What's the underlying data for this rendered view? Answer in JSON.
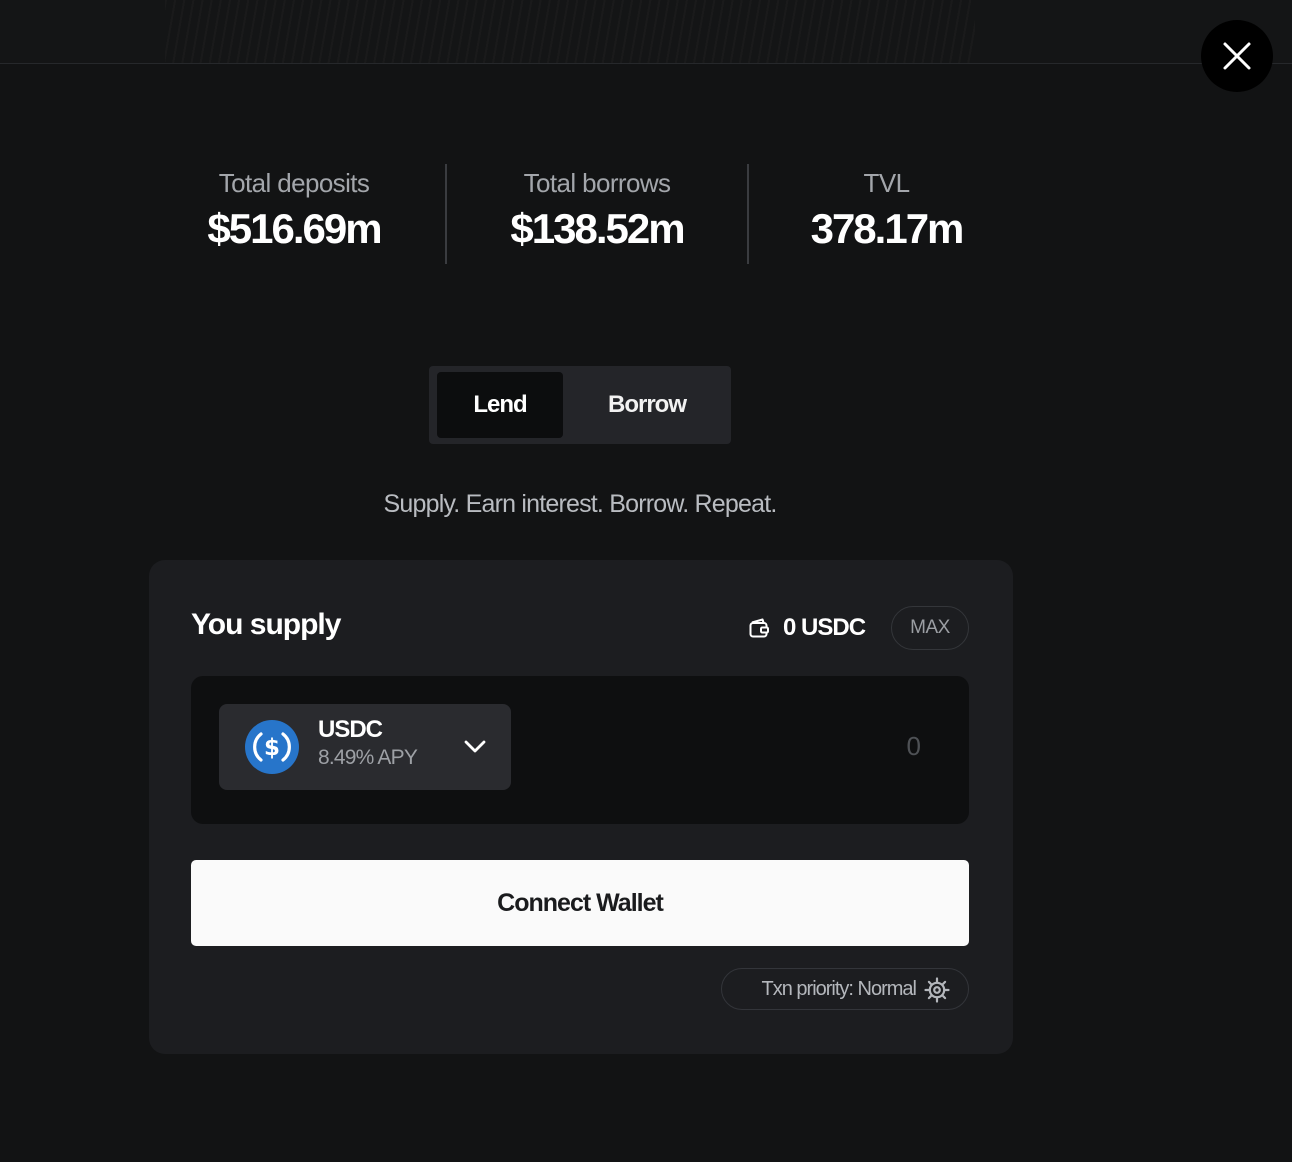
{
  "stats": {
    "deposits": {
      "label": "Total deposits",
      "value": "$516.69m"
    },
    "borrows": {
      "label": "Total borrows",
      "value": "$138.52m"
    },
    "tvl": {
      "label": "TVL",
      "value": "378.17m"
    }
  },
  "mode_toggle": {
    "options": [
      {
        "label": "Lend",
        "selected": true
      },
      {
        "label": "Borrow",
        "selected": false
      }
    ]
  },
  "tagline": "Supply. Earn interest. Borrow. Repeat.",
  "supply_card": {
    "title": "You supply",
    "wallet_balance": "0 USDC",
    "max_label": "MAX",
    "token": {
      "symbol": "USDC",
      "apy": "8.49% APY",
      "icon": "usdc-coin-icon"
    },
    "amount_placeholder": "0",
    "connect_label": "Connect Wallet",
    "priority_label": "Txn priority: Normal"
  },
  "icons": {
    "close": "close-icon",
    "wallet": "wallet-icon",
    "chevron": "chevron-down-icon",
    "gear": "gear-icon"
  },
  "colors": {
    "background": "#121314",
    "card": "#1c1d20",
    "input": "#0e0f10",
    "usdc_blue": "#2775ca",
    "button": "#fafafa"
  }
}
